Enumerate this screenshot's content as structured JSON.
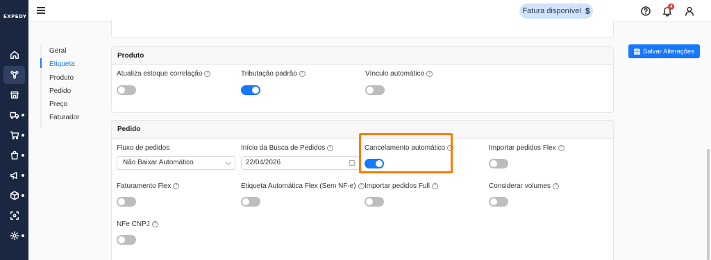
{
  "brand": {
    "logo_text": "EXPEDY"
  },
  "rail": {
    "items": [
      {
        "icon": "home-icon"
      },
      {
        "icon": "integrations-icon",
        "active": true
      },
      {
        "icon": "store-icon"
      },
      {
        "icon": "truck-icon"
      },
      {
        "icon": "cart-icon"
      },
      {
        "icon": "bag-icon"
      },
      {
        "icon": "megaphone-icon"
      },
      {
        "icon": "box-icon"
      },
      {
        "icon": "scan-icon"
      },
      {
        "icon": "settings-icon"
      }
    ]
  },
  "header": {
    "fatura_label": "Fatura disponível",
    "fatura_symbol": "$",
    "notification_count": "4"
  },
  "subnav": {
    "items": [
      "Geral",
      "Etiqueta",
      "Produto",
      "Pedido",
      "Preço",
      "Faturador"
    ],
    "active": "Etiqueta"
  },
  "save_button_label": "Salvar Alterações",
  "produto": {
    "title": "Produto",
    "fields": [
      {
        "label": "Atualiza estoque correlação",
        "on": false
      },
      {
        "label": "Tributação padrão",
        "on": true
      },
      {
        "label": "Vínculo automático",
        "on": false
      }
    ]
  },
  "pedido": {
    "title": "Pedido",
    "fluxo": {
      "label": "Fluxo de pedidos",
      "value": "Não Baixar Automático"
    },
    "inicio": {
      "label": "Início da Busca de Pedidos",
      "value": "22/04/2026"
    },
    "fields": [
      {
        "label": "Cancelamento automático",
        "on": true
      },
      {
        "label": "Importar pedidos Flex",
        "on": false
      },
      {
        "label": "Faturamento Flex",
        "on": false
      },
      {
        "label": "Etiqueta Automática Flex (Sem NF-e)",
        "on": false
      },
      {
        "label": "Importar pedidos Full",
        "on": false
      },
      {
        "label": "Considerar volumes",
        "on": false
      },
      {
        "label": "NFe CNPJ",
        "on": false
      }
    ]
  },
  "colors": {
    "accent": "#1677ff",
    "highlight": "#ff7b00",
    "rail": "#1b2740"
  }
}
